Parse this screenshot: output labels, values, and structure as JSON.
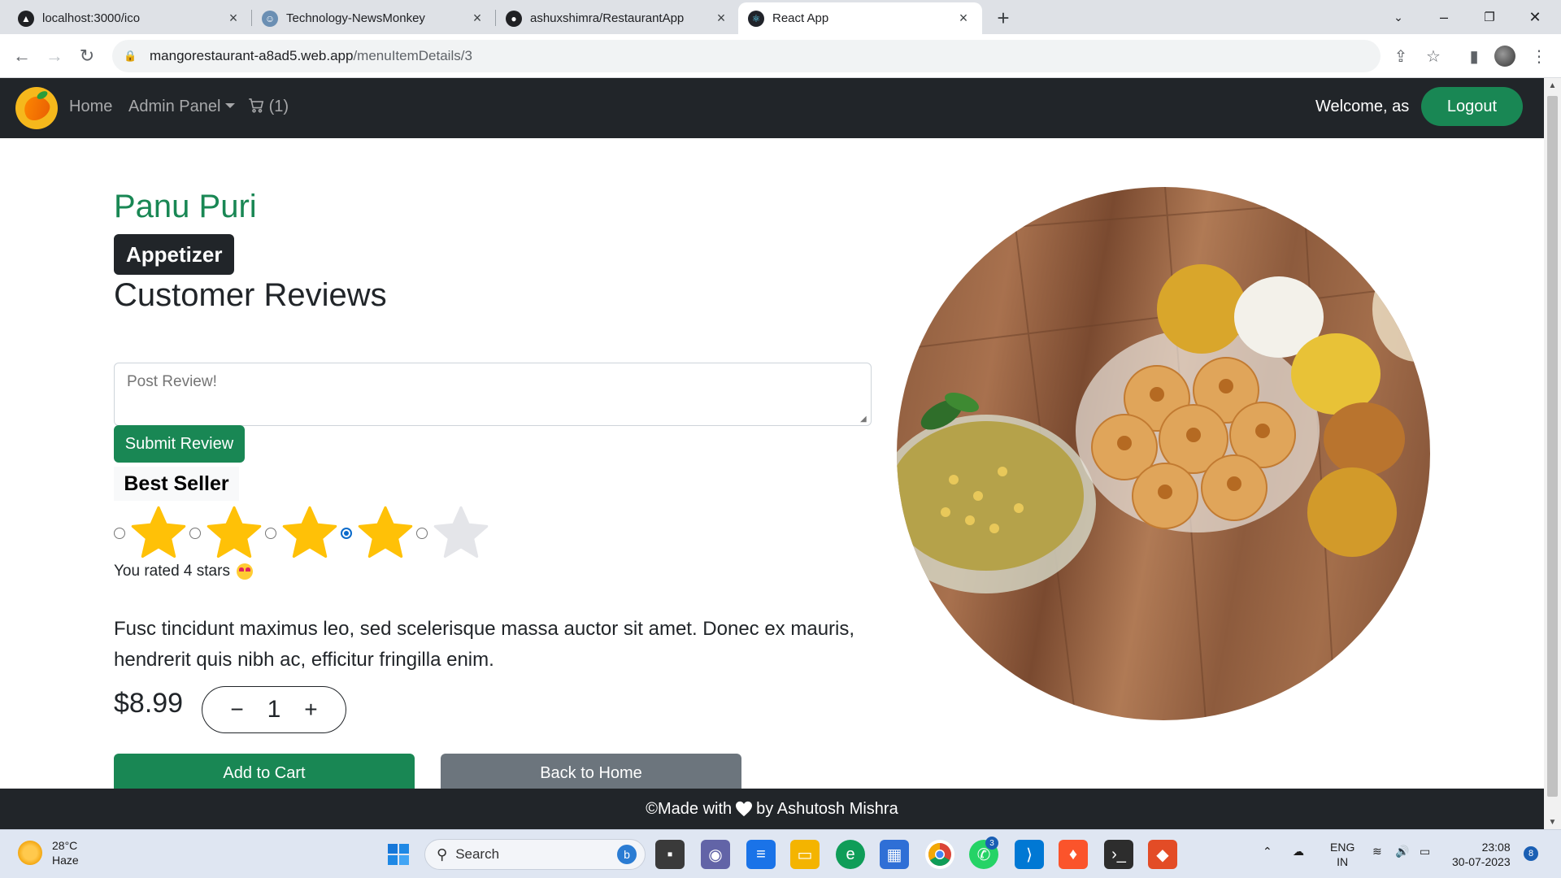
{
  "browser": {
    "tabs": [
      {
        "label": "localhost:3000/ico",
        "icon": "triangle-icon"
      },
      {
        "label": "Technology-NewsMonkey",
        "icon": "monkey-icon"
      },
      {
        "label": "ashuxshimra/RestaurantApp",
        "icon": "github-icon"
      },
      {
        "label": "React App",
        "icon": "react-icon",
        "active": true
      }
    ],
    "url_host": "mangorestaurant-a8ad5.web.app",
    "url_path": "/menuItemDetails/3"
  },
  "navbar": {
    "home": "Home",
    "admin_panel": "Admin Panel",
    "cart": "(1)",
    "welcome": "Welcome, as",
    "logout": "Logout"
  },
  "item": {
    "name": "Panu Puri",
    "category": "Appetizer",
    "reviews_heading": "Customer Reviews",
    "review_placeholder": "Post Review!",
    "submit_label": "Submit Review",
    "tag": "Best Seller",
    "rating": 4,
    "rating_max": 5,
    "rated_text": "You rated 4 stars",
    "description": "Fusc tincidunt maximus leo, sed scelerisque massa auctor sit amet. Donec ex mauris, hendrerit quis nibh ac, efficitur fringilla enim.",
    "price": "$8.99",
    "quantity": "1",
    "add_to_cart": "Add to Cart",
    "back_home": "Back to Home"
  },
  "footer": {
    "prefix": "©Made with",
    "suffix": "by Ashutosh Mishra"
  },
  "colors": {
    "primary_green": "#198754",
    "dark": "#212529",
    "secondary": "#6c757d",
    "star_filled": "#ffc107",
    "star_empty": "#e4e5e9"
  },
  "taskbar": {
    "temperature": "28°C",
    "weather": "Haze",
    "search": "Search",
    "lang1": "ENG",
    "lang2": "IN",
    "time": "23:08",
    "date": "30-07-2023",
    "notifications": "8",
    "whatsapp_badge": "3"
  }
}
